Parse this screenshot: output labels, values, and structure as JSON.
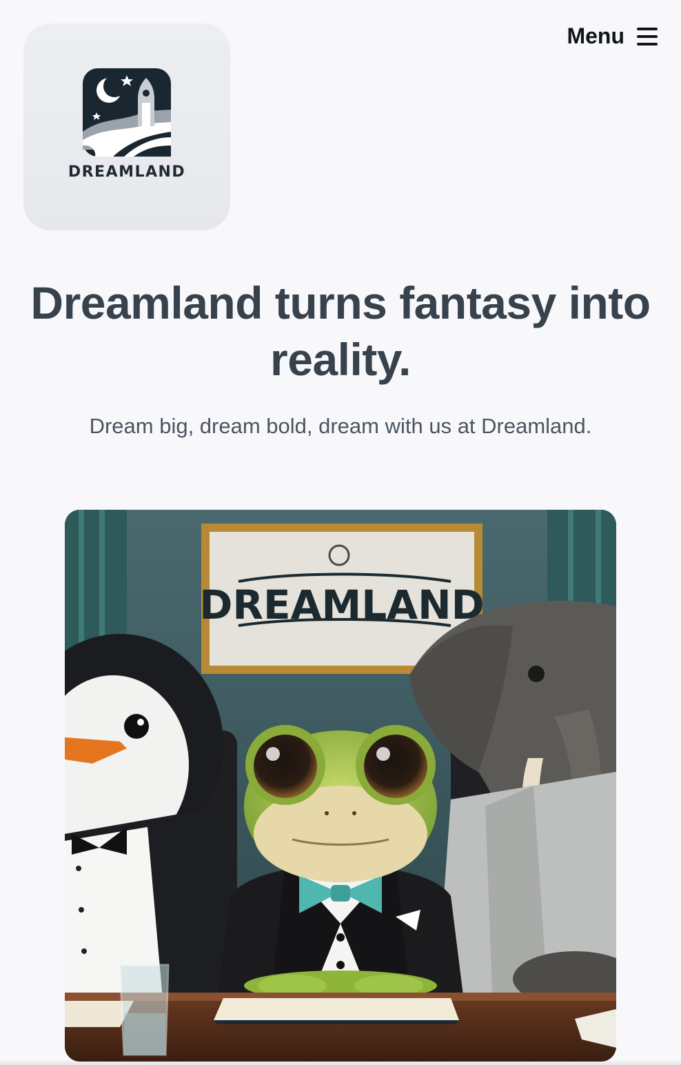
{
  "header": {
    "logo_text": "DREAMLAND",
    "menu_label": "Menu"
  },
  "hero": {
    "headline": "Dreamland turns fantasy into reality.",
    "tagline": "Dream big, dream bold, dream with us at Dreamland."
  },
  "image": {
    "sign_text": "DREAMLAND"
  },
  "colors": {
    "background": "#f8f8fb",
    "headline": "#37424c",
    "tagline": "#4a5560",
    "logo_card": "#e8eaed",
    "menu_text": "#0f1419"
  }
}
